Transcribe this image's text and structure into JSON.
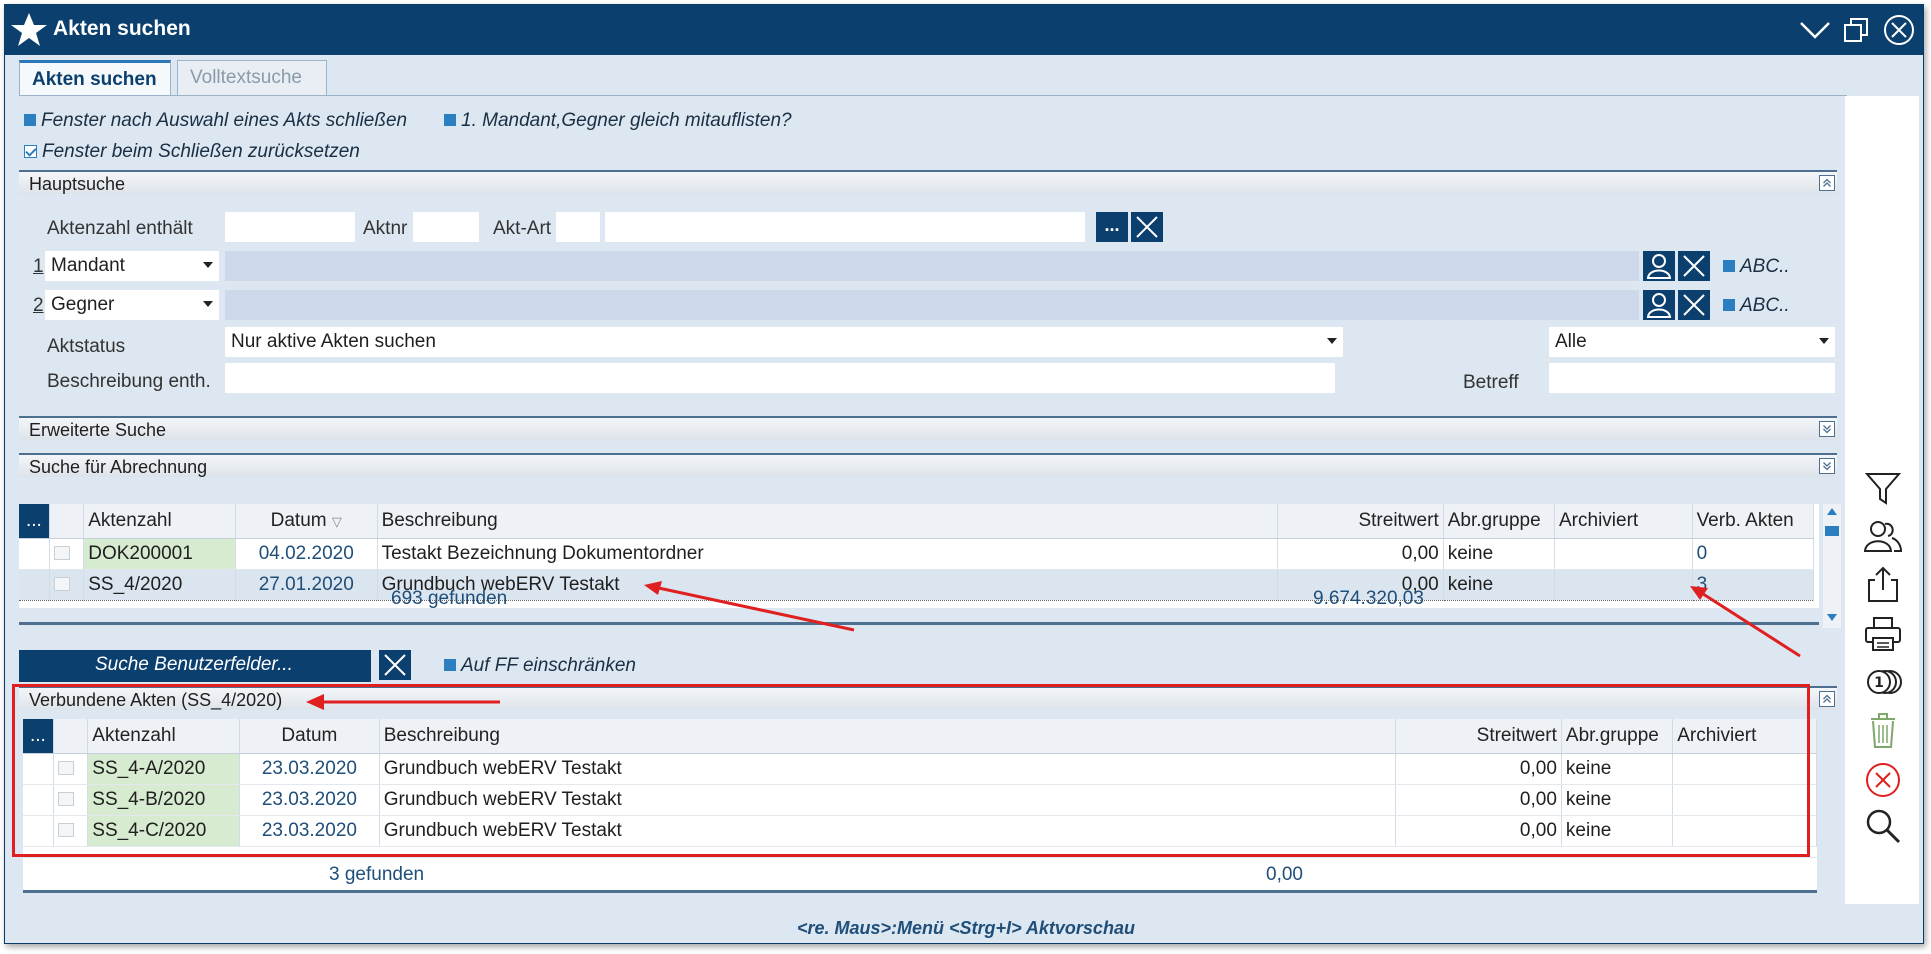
{
  "window": {
    "title": "Akten suchen"
  },
  "tabs": [
    {
      "label": "Akten suchen",
      "active": true
    },
    {
      "label": "Volltextsuche",
      "active": false
    }
  ],
  "options": {
    "close_after_select": "Fenster nach Auswahl eines Akts schließen",
    "list_mandant_gegner": "1. Mandant,Gegner gleich mitauflisten?",
    "reset_on_close": "Fenster beim Schließen zurücksetzen"
  },
  "hauptsuche": {
    "title": "Hauptsuche",
    "aktenzahl_label": "Aktenzahl enthält",
    "aktenzahl_value": "",
    "aktnr_label": "Aktnr",
    "aktnr_value": "",
    "aktart_label": "Akt-Art",
    "aktart_code": "",
    "aktart_value": "",
    "dots_label": "...",
    "party1_index": "1",
    "party1_role": "Mandant",
    "party1_value": "",
    "party2_index": "2",
    "party2_role": "Gegner",
    "party2_value": "",
    "abc_label": "ABC..",
    "aktstatus_label": "Aktstatus",
    "aktstatus_value": "Nur aktive Akten suchen",
    "status2_value": "Alle",
    "beschreibung_label": "Beschreibung enth.",
    "beschreibung_value": "",
    "betreff_label": "Betreff",
    "betreff_value": ""
  },
  "sections": {
    "erweitert": "Erweiterte Suche",
    "abrechnung": "Suche für Abrechnung"
  },
  "results": {
    "menu_label": "...",
    "columns": [
      "Aktenzahl",
      "Datum",
      "Beschreibung",
      "Streitwert",
      "Abr.gruppe",
      "Archiviert",
      "Verb. Akten"
    ],
    "rows": [
      {
        "aktenzahl": "DOK200001",
        "datum": "04.02.2020",
        "beschreibung": "Testakt Bezeichnung Dokumentordner",
        "streitwert": "0,00",
        "abrgruppe": "keine",
        "archiviert": "",
        "verb": "0"
      },
      {
        "aktenzahl": "SS_4/2020",
        "datum": "27.01.2020",
        "beschreibung": "Grundbuch webERV Testakt",
        "streitwert": "0,00",
        "abrgruppe": "keine",
        "archiviert": "",
        "verb": "3"
      }
    ],
    "found": "693 gefunden",
    "total": "9.674.320,03"
  },
  "userfields": {
    "button": "Suche Benutzerfelder...",
    "restrict": "Auf FF einschränken"
  },
  "linked": {
    "title": "Verbundene Akten (SS_4/2020)",
    "menu_label": "...",
    "columns": [
      "Aktenzahl",
      "Datum",
      "Beschreibung",
      "Streitwert",
      "Abr.gruppe",
      "Archiviert"
    ],
    "rows": [
      {
        "aktenzahl": "SS_4-A/2020",
        "datum": "23.03.2020",
        "beschreibung": "Grundbuch webERV Testakt",
        "streitwert": "0,00",
        "abrgruppe": "keine",
        "archiviert": ""
      },
      {
        "aktenzahl": "SS_4-B/2020",
        "datum": "23.03.2020",
        "beschreibung": "Grundbuch webERV Testakt",
        "streitwert": "0,00",
        "abrgruppe": "keine",
        "archiviert": ""
      },
      {
        "aktenzahl": "SS_4-C/2020",
        "datum": "23.03.2020",
        "beschreibung": "Grundbuch webERV Testakt",
        "streitwert": "0,00",
        "abrgruppe": "keine",
        "archiviert": ""
      }
    ],
    "found": "3 gefunden",
    "total": "0,00"
  },
  "statusbar": {
    "hint": "<re. Maus>:Menü  <Strg+I> Aktvorschau"
  },
  "sidebar_icons": [
    "filter-icon",
    "persons-icon",
    "export-icon",
    "print-icon",
    "coins-icon",
    "trash-icon",
    "cancel-icon",
    "search-icon"
  ],
  "colors": {
    "titlebar": "#0b3f6e",
    "background": "#dde7f1",
    "accent": "#2b7fc0",
    "highlight_box": "#e02020"
  }
}
